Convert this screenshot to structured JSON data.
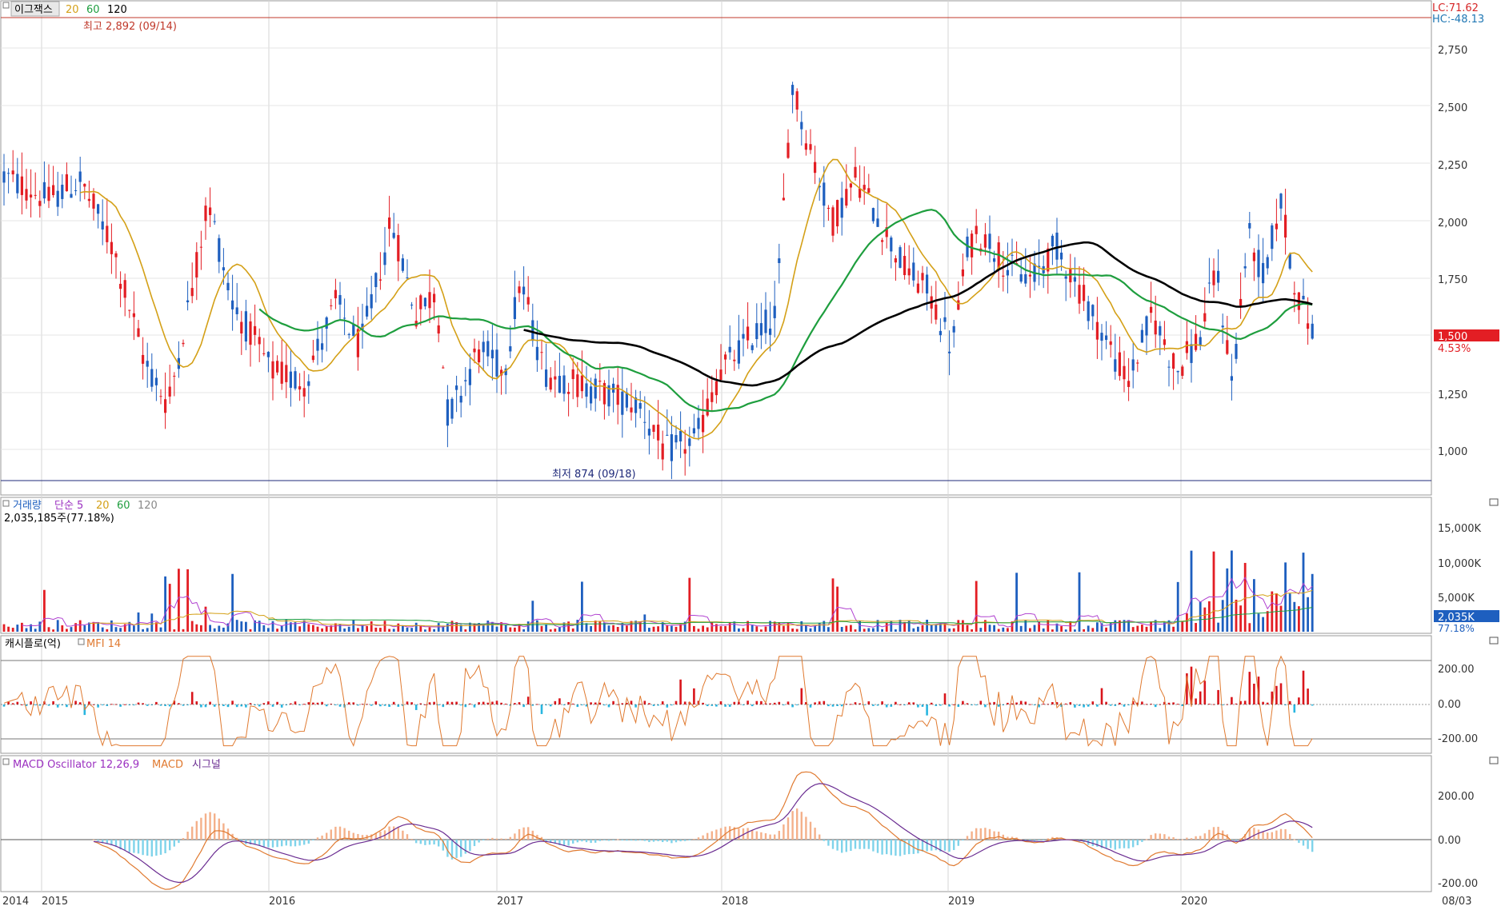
{
  "price_panel": {
    "stock_name": "이그잭스",
    "ma_labels": [
      "20",
      "60",
      "120"
    ],
    "ma_colors": [
      "#d4a017",
      "#1e9e3e",
      "#000000"
    ],
    "lc": "LC:71.62",
    "hc": "HC:-48.13",
    "high_note": "최고 2,892 (09/14)",
    "low_note": "최저 874 (09/18)",
    "current_price": "1,500",
    "change_pct": "4.53%",
    "y_ticks": [
      "2,750",
      "2,500",
      "2,250",
      "2,000",
      "1,750",
      "1,500",
      "1,250",
      "1,000"
    ]
  },
  "volume_panel": {
    "title": "거래량",
    "ma_label": "단순 5",
    "ma_periods": [
      "20",
      "60",
      "120"
    ],
    "value": "2,035,185주(77.18%)",
    "current": "2,035K",
    "current_pct": "77.18%",
    "y_ticks": [
      "15,000K",
      "10,000K",
      "5,000K"
    ]
  },
  "cashflow_panel": {
    "title": "캐시플로(억)",
    "indicator": "MFI 14",
    "y_ticks": [
      "200.00",
      "0.00",
      "-200.00"
    ]
  },
  "macd_panel": {
    "title": "MACD Oscillator 12,26,9",
    "macd_label": "MACD",
    "signal_label": "시그널",
    "y_ticks": [
      "200.00",
      "0.00",
      "-200.00"
    ]
  },
  "x_axis": {
    "labels": [
      "2014",
      "2015",
      "2016",
      "2017",
      "2018",
      "2019",
      "2020"
    ],
    "last_date": "08/03"
  },
  "colors": {
    "up": "#e31e24",
    "down": "#1e5fbf",
    "macd": "#e07a30",
    "signal": "#6a2c91",
    "osc_pos": "#f4b08a",
    "osc_neg": "#7fd3ea",
    "cash_pos": "#d9151b",
    "cash_neg": "#29b6e0"
  },
  "chart_data": {
    "type": "candlestick",
    "ylim": [
      874,
      2892
    ],
    "period_high": 2892,
    "period_low": 874,
    "last_close": 1500,
    "last_change_pct": 4.53,
    "price_close_by_year_start": {
      "2015": 2080,
      "2016": 1280,
      "2017": 1480,
      "2018": 1420,
      "2019": 1560,
      "2020": 1300
    },
    "last_volume": 2035185,
    "ma_periods": [
      20,
      60,
      120
    ]
  }
}
